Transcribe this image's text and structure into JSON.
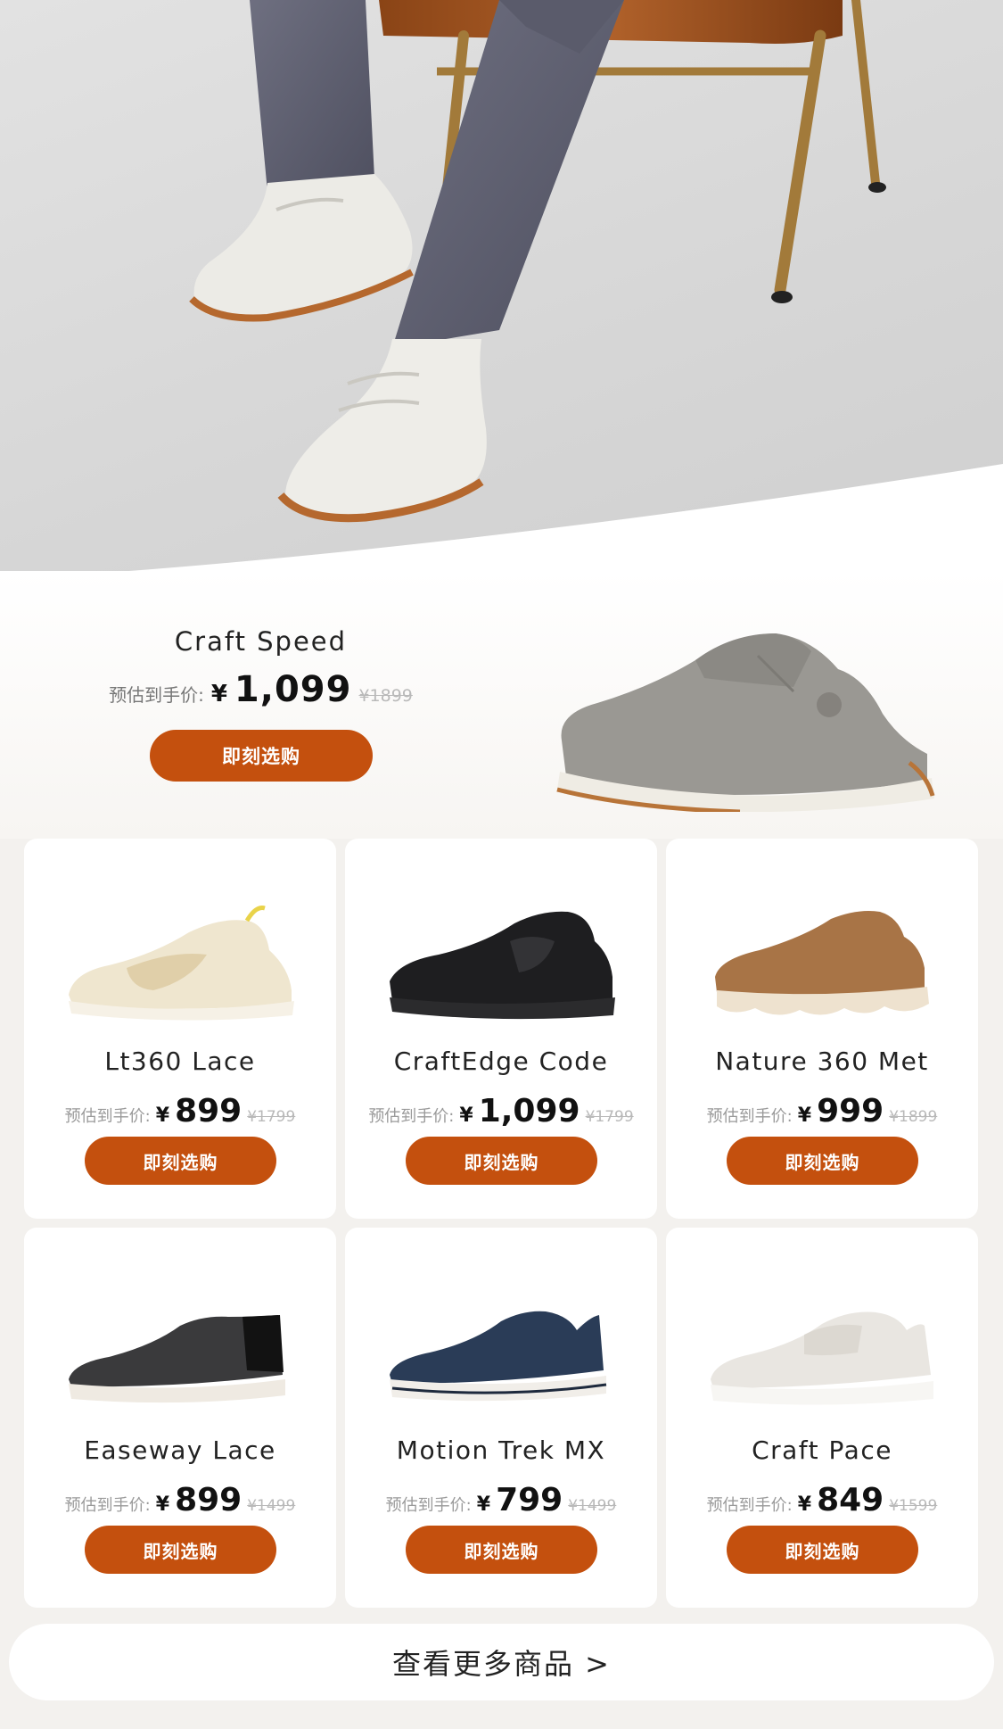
{
  "featured": {
    "name": "Craft Speed",
    "est_label": "预估到手价:",
    "currency": "¥",
    "price": "1,099",
    "original_price": "¥1899",
    "button_label": "即刻选购",
    "image": "grey-suede-sneaker"
  },
  "products": [
    {
      "name": "Lt360 Lace",
      "est_label": "预估到手价:",
      "currency": "¥",
      "price": "899",
      "original_price": "¥1799",
      "button_label": "即刻选购",
      "image": "cream-runner-sneaker"
    },
    {
      "name": "CraftEdge Code",
      "est_label": "预估到手价:",
      "currency": "¥",
      "price": "1,099",
      "original_price": "¥1799",
      "button_label": "即刻选购",
      "image": "black-leather-sneaker"
    },
    {
      "name": "Nature 360 Met",
      "est_label": "预估到手价:",
      "currency": "¥",
      "price": "999",
      "original_price": "¥1899",
      "button_label": "即刻选购",
      "image": "tan-suede-sneaker"
    },
    {
      "name": "Easeway Lace",
      "est_label": "预估到手价:",
      "currency": "¥",
      "price": "899",
      "original_price": "¥1499",
      "button_label": "即刻选购",
      "image": "black-knit-sneaker"
    },
    {
      "name": "Motion Trek MX",
      "est_label": "预估到手价:",
      "currency": "¥",
      "price": "799",
      "original_price": "¥1499",
      "button_label": "即刻选购",
      "image": "navy-knit-sneaker"
    },
    {
      "name": "Craft Pace",
      "est_label": "预估到手价:",
      "currency": "¥",
      "price": "849",
      "original_price": "¥1599",
      "button_label": "即刻选购",
      "image": "white-leather-sneaker"
    }
  ],
  "more_label": "查看更多商品 >",
  "colors": {
    "accent": "#c4500e",
    "background": "#f3f1ee",
    "card": "#ffffff"
  }
}
